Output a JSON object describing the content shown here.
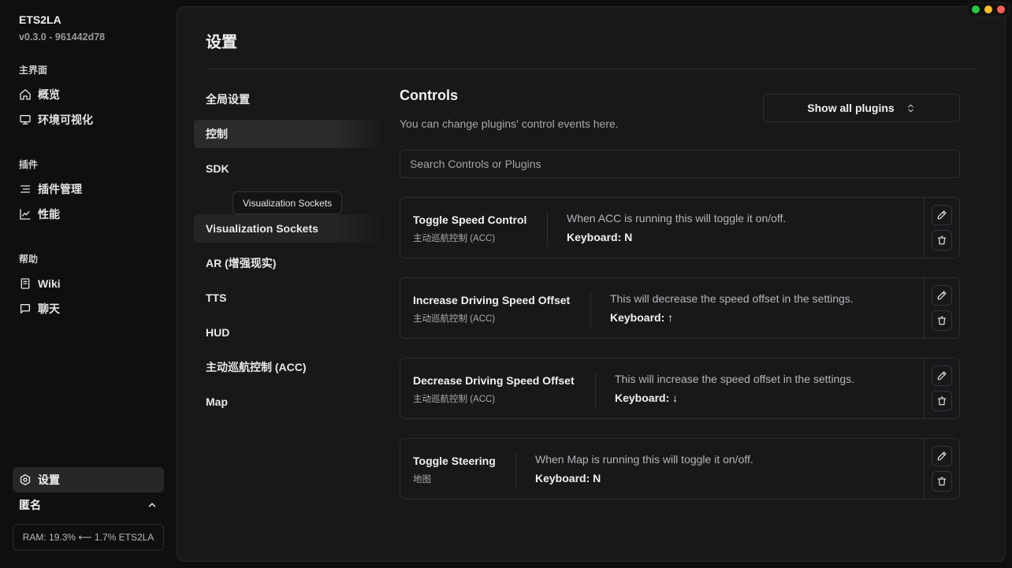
{
  "app": {
    "name": "ETS2LA",
    "version": "v0.3.0 - 961442d78"
  },
  "sidebar": {
    "sections": [
      {
        "label": "主界面",
        "items": [
          {
            "label": "概览",
            "icon": "home-icon"
          },
          {
            "label": "环境可视化",
            "icon": "monitor-icon"
          }
        ]
      },
      {
        "label": "插件",
        "items": [
          {
            "label": "插件管理",
            "icon": "list-icon"
          },
          {
            "label": "性能",
            "icon": "chart-icon"
          }
        ]
      },
      {
        "label": "帮助",
        "items": [
          {
            "label": "Wiki",
            "icon": "book-icon"
          },
          {
            "label": "聊天",
            "icon": "chat-icon"
          }
        ]
      }
    ],
    "active_item": {
      "label": "设置",
      "icon": "gear-icon"
    },
    "user": {
      "label": "匿名"
    },
    "status": "RAM: 19.3% ⟵ 1.7% ETS2LA"
  },
  "settings": {
    "title": "设置",
    "tabs": [
      {
        "label": "全局设置"
      },
      {
        "label": "控制",
        "state": "active"
      },
      {
        "label": "SDK"
      },
      {
        "label": "Visualization Sockets",
        "state": "hover"
      },
      {
        "label": "AR (增强现实)"
      },
      {
        "label": "TTS"
      },
      {
        "label": "HUD"
      },
      {
        "label": "主动巡航控制 (ACC)"
      },
      {
        "label": "Map"
      }
    ],
    "tooltip": "Visualization Sockets"
  },
  "controls": {
    "title": "Controls",
    "subtitle": "You can change plugins' control events here.",
    "filter_label": "Show all plugins",
    "search_placeholder": "Search Controls or Plugins",
    "items": [
      {
        "name": "Toggle Speed Control",
        "plugin": "主动巡航控制 (ACC)",
        "description": "When ACC is running this will toggle it on/off.",
        "key": "Keyboard: N"
      },
      {
        "name": "Increase Driving Speed Offset",
        "plugin": "主动巡航控制 (ACC)",
        "description": "This will decrease the speed offset in the settings.",
        "key": "Keyboard: ↑"
      },
      {
        "name": "Decrease Driving Speed Offset",
        "plugin": "主动巡航控制 (ACC)",
        "description": "This will increase the speed offset in the settings.",
        "key": "Keyboard: ↓"
      },
      {
        "name": "Toggle Steering",
        "plugin": "地图",
        "description": "When Map is running this will toggle it on/off.",
        "key": "Keyboard: N"
      }
    ]
  },
  "colors": {
    "background": "#0f0f10",
    "panel": "#18181a",
    "border": "#2f2f33",
    "active": "#27272a",
    "dot_green": "#28c840",
    "dot_yellow": "#febc2e",
    "dot_red": "#ff5f57"
  }
}
